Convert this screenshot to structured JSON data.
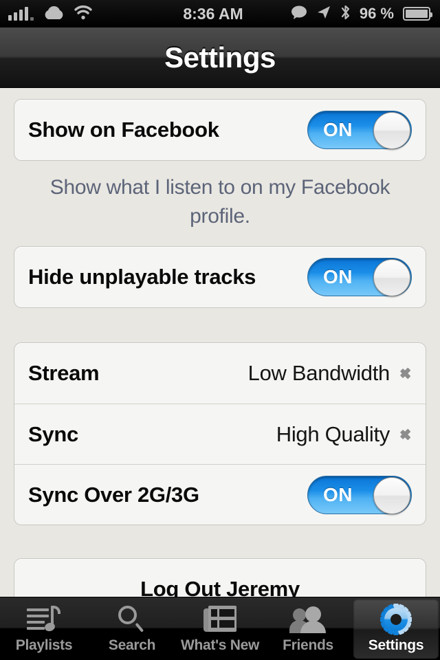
{
  "status_bar": {
    "signal_icon": "signal-bars-icon",
    "cloud_icon": "cloud-icon",
    "wifi_icon": "wifi-icon",
    "time": "8:36 AM",
    "message_icon": "speech-bubble-icon",
    "location_icon": "location-arrow-icon",
    "bluetooth_icon": "bluetooth-icon",
    "battery_percent": "96 %",
    "battery_icon": "battery-icon"
  },
  "navbar": {
    "title": "Settings"
  },
  "groups": {
    "facebook": {
      "row_label": "Show on Facebook",
      "toggle_value": "ON",
      "footnote": "Show what I listen to on my Facebook profile."
    },
    "tracks": {
      "row_label": "Hide unplayable tracks",
      "toggle_value": "ON"
    },
    "quality": {
      "stream_label": "Stream",
      "stream_value": "Low Bandwidth",
      "sync_label": "Sync",
      "sync_value": "High Quality",
      "sync_cellular_label": "Sync Over 2G/3G",
      "sync_cellular_toggle": "ON",
      "chevron_icon": "chevron-right-icon"
    },
    "account": {
      "logout_label": "Log Out Jeremy"
    }
  },
  "tabbar": {
    "tabs": [
      {
        "label": "Playlists",
        "icon": "playlists-icon",
        "active": false
      },
      {
        "label": "Search",
        "icon": "search-icon",
        "active": false
      },
      {
        "label": "What's New",
        "icon": "newspaper-icon",
        "active": false
      },
      {
        "label": "Friends",
        "icon": "friends-icon",
        "active": false
      },
      {
        "label": "Settings",
        "icon": "gear-icon",
        "active": true
      }
    ]
  },
  "colors": {
    "toggle_on_blue": "#1b8ee8",
    "background": "#e9e7e2",
    "card": "#f5f5f3",
    "footnote_text": "#5c6478",
    "chevron_gray": "#8d8d8d",
    "tab_inactive": "#9a9a9a",
    "gear_blue": "#29a3f0"
  }
}
